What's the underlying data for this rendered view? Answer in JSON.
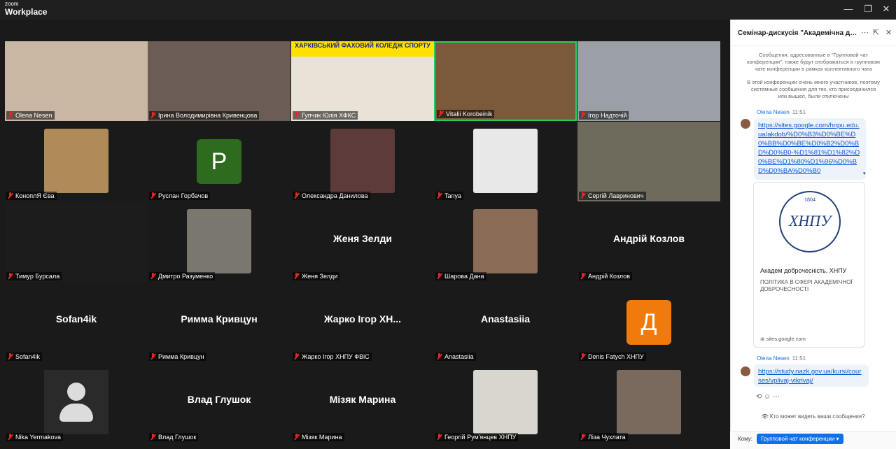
{
  "app": {
    "zoom": "zoom",
    "workplace": "Workplace"
  },
  "window": {
    "minimize": "—",
    "restore": "❐",
    "close": "✕"
  },
  "tiles": [
    {
      "name": "Olena Nesen",
      "type": "video",
      "bg": "#c9b7a4"
    },
    {
      "name": "Ірина Володимирівна Кривенцова",
      "type": "video",
      "bg": "#6b5d55"
    },
    {
      "name": "Гупчик Юлія ХФКС",
      "type": "video",
      "bg": "#e9e2d6",
      "banner": "ХАРКІВСЬКИЙ ФАХОВИЙ КОЛЕДЖ СПОРТУ"
    },
    {
      "name": "Vitalii Korobeinik",
      "type": "video",
      "bg": "#7a5a3a",
      "active": true
    },
    {
      "name": "Ігор Надточій",
      "type": "video",
      "bg": "#9aa0a5"
    },
    {
      "name": "КоноплЯ Єва",
      "type": "photo",
      "bg": "#b08b5a"
    },
    {
      "name": "Руслан Горбачов",
      "type": "letter",
      "letter": "P",
      "color": "#2e6b1f"
    },
    {
      "name": "Олександра Данилова",
      "type": "photo",
      "bg": "#5c3b3a"
    },
    {
      "name": "Tanya",
      "type": "photo",
      "bg": "#e8e8e8"
    },
    {
      "name": "Сергій Лавринович",
      "type": "video",
      "bg": "#6e6a5c"
    },
    {
      "name": "Тимур Бурсала",
      "type": "video",
      "bg": "#1c1c1c"
    },
    {
      "name": "Дмитро Разуменко",
      "type": "photo",
      "bg": "#7a776f"
    },
    {
      "name": "Женя Зелди",
      "type": "text",
      "display": "Женя Зелди"
    },
    {
      "name": "Шарова Дана",
      "type": "photo",
      "bg": "#8a6b55"
    },
    {
      "name": "Андрій Козлов",
      "type": "text",
      "display": "Андрій Козлов"
    },
    {
      "name": "Sofan4ik",
      "type": "text",
      "display": "Sofan4ik"
    },
    {
      "name": "Римма Кривцун",
      "type": "text",
      "display": "Римма Кривцун"
    },
    {
      "name": "Жарко Ігор ХНПУ ФВіС",
      "type": "text",
      "display": "Жарко Ігор ХН..."
    },
    {
      "name": "Anastasiia",
      "type": "text",
      "display": "Anastasiia"
    },
    {
      "name": "Denis Fatych ХНПУ",
      "type": "letter",
      "letter": "Д",
      "color": "#f07a0b"
    },
    {
      "name": "Nika Yermakova",
      "type": "default-avatar"
    },
    {
      "name": "Влад Глушок",
      "type": "text",
      "display": "Влад Глушок"
    },
    {
      "name": "Мізяк Марина",
      "type": "text",
      "display": "Мізяк Марина"
    },
    {
      "name": "Георгій Рум'янцев ХНПУ",
      "type": "photo",
      "bg": "#d9d6d0"
    },
    {
      "name": "Ліза Чухлата",
      "type": "photo",
      "bg": "#7a6a5e"
    }
  ],
  "chat": {
    "title": "Семінар-дискусія \"Академічна добро...",
    "sys1": "Сообщения, адресованные в \"Групповой чат конференции\", также будут отображаться в групповом чате конференции в рамках коллективного чата",
    "sys2": "В этой конференции очень много участников, поэтому системные сообщения для тех, кто присоединился или вышел, были отключены",
    "msg1": {
      "sender": "Olena Nesen",
      "time": "11:51",
      "text": "https://sites.google.com/hnpu.edu.ua/akdob/%D0%B3%D0%BE%D0%BB%D0%BE%D0%B2%D0%BD%D0%B0-%D1%81%D1%82%D0%BE%D1%80%D1%96%D0%BD%D0%BA%D0%B0"
    },
    "preview": {
      "logo_year": "1804",
      "logo_text": "ХНПУ",
      "title": "Академ доброчесність. ХНПУ",
      "desc": "ПОЛІТИКА В СФЕРІ АКАДЕМІЧНОЇ ДОБРОЧЕСНОСТІ",
      "domain": "sites.google.com"
    },
    "msg2": {
      "sender": "Olena Nesen",
      "time": "11:51",
      "text": "https://study.nazk.gov.ua/kursi/courses/vplivaj-vikrivaj/"
    },
    "visibility": "Кто может видеть ваши сообщения?",
    "to_label": "Кому:",
    "to_value": "Групповой чат конференции"
  }
}
